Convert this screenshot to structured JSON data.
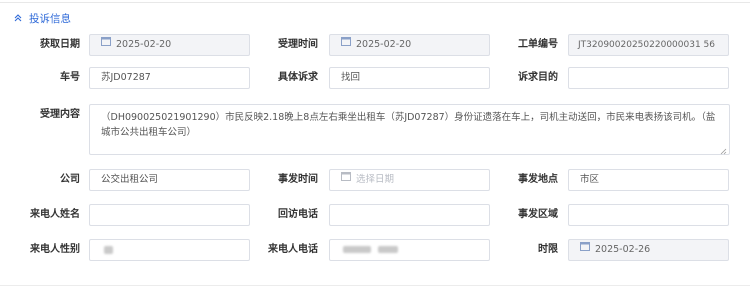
{
  "section": {
    "title": "投诉信息"
  },
  "fields": {
    "acquire_date": {
      "label": "获取日期",
      "value": "2025-02-20"
    },
    "accept_time": {
      "label": "受理时间",
      "value": "2025-02-20"
    },
    "ticket_no": {
      "label": "工单编号",
      "value": "JT32090020250220000031 56"
    },
    "car_no": {
      "label": "车号",
      "value": "苏JD07287"
    },
    "appeal": {
      "label": "具体诉求",
      "value": "找回"
    },
    "appeal_purpose": {
      "label": "诉求目的",
      "value": ""
    },
    "content": {
      "label": "受理内容",
      "value": "（DH090025021901290）市民反映2.18晚上8点左右乘坐出租车（苏JD07287）身份证遗落在车上，司机主动送回，市民来电表扬该司机。（盐城市公共出租车公司）"
    },
    "company": {
      "label": "公司",
      "value": "公交出租公司"
    },
    "incident_time": {
      "label": "事发时间",
      "placeholder": "选择日期"
    },
    "incident_place": {
      "label": "事发地点",
      "value": "市区"
    },
    "caller_name": {
      "label": "来电人姓名",
      "value": ""
    },
    "callback_phone": {
      "label": "回访电话",
      "value": ""
    },
    "incident_area": {
      "label": "事发区域",
      "value": ""
    },
    "caller_gender": {
      "label": "来电人性别",
      "value": ""
    },
    "caller_phone": {
      "label": "来电人电话",
      "value": ""
    },
    "deadline": {
      "label": "时限",
      "value": "2025-02-26"
    }
  },
  "icons": {
    "collapse": "chevron-up-double-icon",
    "calendar": "calendar-icon"
  },
  "colors": {
    "accent": "#2f6ad8",
    "border": "#dcdfe6",
    "disabled_bg": "#f3f4f7"
  }
}
